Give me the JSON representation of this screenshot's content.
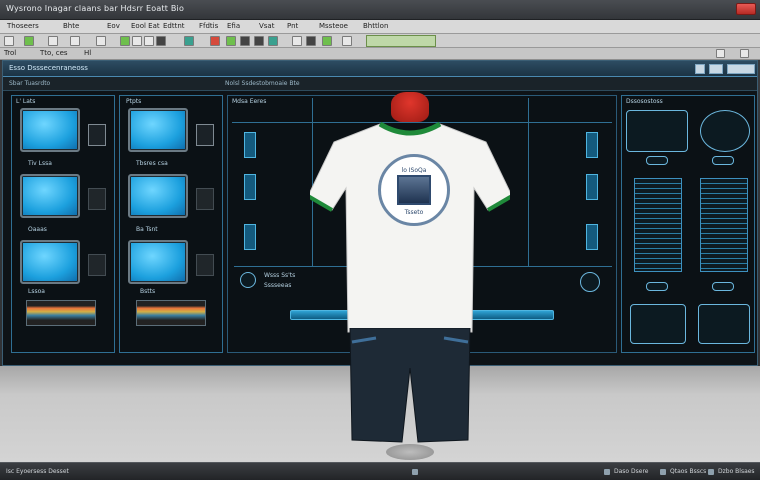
{
  "window": {
    "title": "Wysrono Inagar claans bar Hdsrr Eoatt Bio"
  },
  "menubar": {
    "items": [
      "Thoseers",
      "Bhte",
      "Eov",
      "Eool Eat",
      "Edttnt",
      "Ffdtis",
      "Efia",
      "Vsat",
      "Pnt",
      "Mssteoe",
      "Bhttlon"
    ]
  },
  "pathbar": {
    "items": [
      "Trol",
      "Tto, ces",
      "Hl"
    ]
  },
  "main": {
    "header_title": "Esso Dsssecenraneoss",
    "subheader_left": "Sbar Tuasrdto",
    "subheader_mid": "Nolsl Ssdestobmoaie Bte",
    "left_panel": {
      "label_top": "L' Lats",
      "label_mid": "Tiv Lssa",
      "label_mid2": "Oaaas",
      "label_bot": "Lssoa"
    },
    "mid_left_panel": {
      "label_top": "Ptpts",
      "label_mid": "Tbsres csa",
      "label_mid2": "Ba Tsnt",
      "label_bot": "Bstts"
    },
    "center_panel": {
      "label_top": "Mdsa Eeres",
      "row_label_1": "Wsss Ss'ts",
      "row_label_2": "Sssseeas"
    },
    "right_panel": {
      "label_top": "Dssosostoss"
    }
  },
  "mannequin": {
    "emblem_text_top": "lo ISoQa",
    "emblem_text_bottom": "Tsseto",
    "colors": {
      "neck": "#c2261e",
      "shirt": "#f4f4f2",
      "trim": "#1f8a3a",
      "shorts": "#1e2a36"
    }
  },
  "statusbar": {
    "left": "Isc Eyoersess Desset",
    "right_1": "Daso Dsere",
    "right_2": "Qtaos Bsscs",
    "right_3": "Dzbo Blsaes"
  }
}
